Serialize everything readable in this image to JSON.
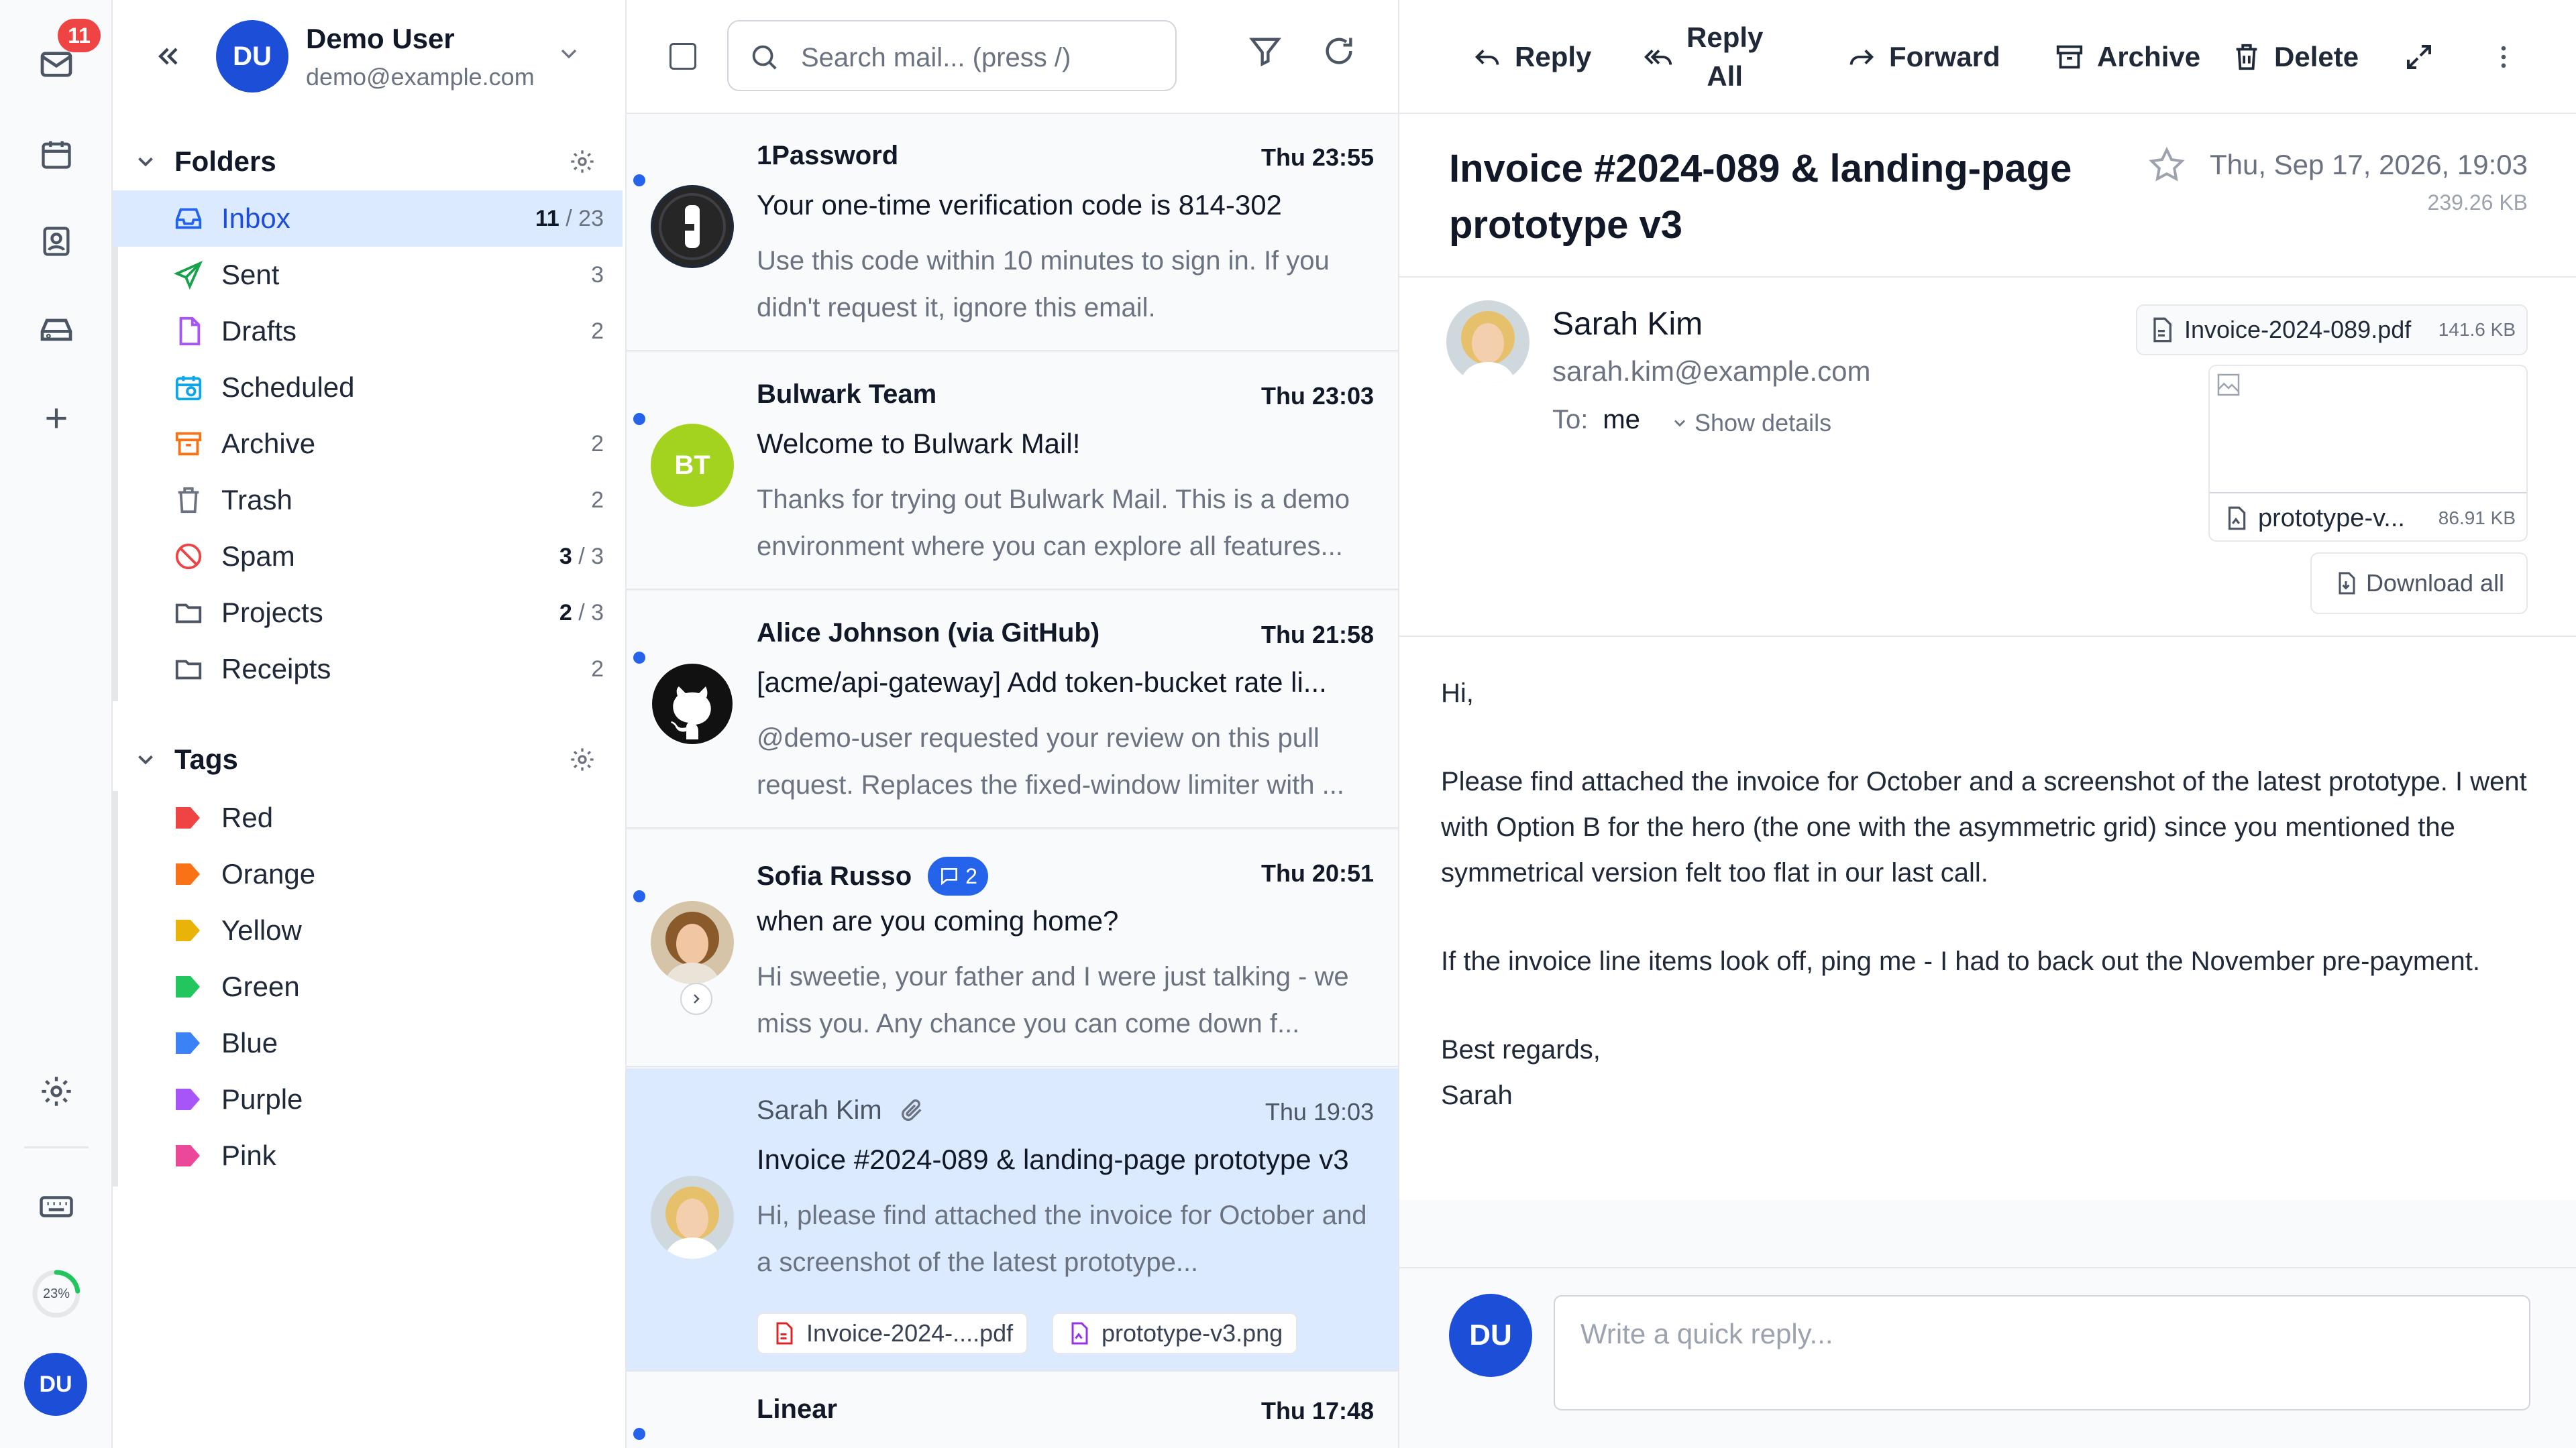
{
  "rail": {
    "badge": "11",
    "storage_percent": "23%",
    "storage_fraction": 0.23,
    "avatar": "DU"
  },
  "account": {
    "initials": "DU",
    "name": "Demo User",
    "email": "demo@example.com"
  },
  "folders": {
    "title": "Folders",
    "items": [
      {
        "name": "Inbox",
        "unread": "11",
        "total": "/ 23",
        "icon": "inbox-icon",
        "color": "#2563eb"
      },
      {
        "name": "Sent",
        "unread": "",
        "total": "3",
        "icon": "send-icon",
        "color": "#16a34a"
      },
      {
        "name": "Drafts",
        "unread": "",
        "total": "2",
        "icon": "draft-icon",
        "color": "#a855f7"
      },
      {
        "name": "Scheduled",
        "unread": "",
        "total": "",
        "icon": "calendar-clock-icon",
        "color": "#0ea5e9"
      },
      {
        "name": "Archive",
        "unread": "",
        "total": "2",
        "icon": "archive-icon",
        "color": "#f97316"
      },
      {
        "name": "Trash",
        "unread": "",
        "total": "2",
        "icon": "trash-icon",
        "color": "#6b7280"
      },
      {
        "name": "Spam",
        "unread": "3",
        "total": "/ 3",
        "icon": "ban-icon",
        "color": "#ef4444"
      },
      {
        "name": "Projects",
        "unread": "2",
        "total": "/ 3",
        "icon": "folder-icon",
        "color": "#4b5563"
      },
      {
        "name": "Receipts",
        "unread": "",
        "total": "2",
        "icon": "folder-icon",
        "color": "#4b5563"
      }
    ]
  },
  "tags": {
    "title": "Tags",
    "items": [
      {
        "name": "Red",
        "color": "#ef4444"
      },
      {
        "name": "Orange",
        "color": "#f97316"
      },
      {
        "name": "Yellow",
        "color": "#eab308"
      },
      {
        "name": "Green",
        "color": "#22c55e"
      },
      {
        "name": "Blue",
        "color": "#3b82f6"
      },
      {
        "name": "Purple",
        "color": "#a855f7"
      },
      {
        "name": "Pink",
        "color": "#ec4899"
      }
    ]
  },
  "search": {
    "placeholder": "Search mail... (press /)"
  },
  "messages": [
    {
      "from": "1Password",
      "time": "Thu 23:55",
      "subject": "Your one-time verification code is 814-302",
      "preview": "Use this code within 10 minutes to sign in. If you didn't request it, ignore this email.",
      "avatar": ""
    },
    {
      "from": "Bulwark Team",
      "time": "Thu 23:03",
      "subject": "Welcome to Bulwark Mail!",
      "preview": "Thanks for trying out Bulwark Mail. This is a demo environment where you can explore all features...",
      "avatar": "BT"
    },
    {
      "from": "Alice Johnson (via GitHub)",
      "time": "Thu 21:58",
      "subject": "[acme/api-gateway] Add token-bucket rate li...",
      "preview": "@demo-user requested your review on this pull request. Replaces the fixed-window limiter with ...",
      "avatar": ""
    },
    {
      "from": "Sofia Russo",
      "thread_count": "2",
      "time": "Thu 20:51",
      "subject": "when are you coming home?",
      "preview": "Hi sweetie, your father and I were just talking - we miss you. Any chance you can come down f...",
      "avatar": ""
    },
    {
      "from": "Sarah Kim",
      "time": "Thu 19:03",
      "subject": "Invoice #2024-089 & landing-page prototype v3",
      "preview": "Hi, please find attached the invoice for October and a screenshot of the latest prototype...",
      "attachments": [
        "Invoice-2024-....pdf",
        "prototype-v3.png"
      ]
    },
    {
      "from": "Linear",
      "time": "Thu 17:48"
    }
  ],
  "toolbar": {
    "reply": "Reply",
    "reply_all_1": "Reply",
    "reply_all_2": "All",
    "forward": "Forward",
    "archive": "Archive",
    "delete": "Delete"
  },
  "reader": {
    "title": "Invoice #2024-089 & landing-page prototype v3",
    "date": "Thu, Sep 17, 2026, 19:03",
    "size": "239.26 KB",
    "sender_name": "Sarah Kim",
    "sender_email": "sarah.kim@example.com",
    "to_label": "To:",
    "to_value": "me",
    "show_details": "Show details",
    "attachments": [
      {
        "name": "Invoice-2024-089.pdf",
        "size": "141.6 KB"
      },
      {
        "name": "prototype-v...",
        "size": "86.91 KB"
      }
    ],
    "download_all": "Download all",
    "body": [
      "Hi,",
      "Please find attached the invoice for October and a screenshot of the latest prototype. I went with Option B for the hero (the one with the asymmetric grid) since you mentioned the symmetrical version felt too flat in our last call.",
      "If the invoice line items look off, ping me - I had to back out the November pre-payment.",
      "Best regards,",
      "Sarah"
    ],
    "reply_avatar": "DU",
    "reply_placeholder": "Write a quick reply..."
  }
}
